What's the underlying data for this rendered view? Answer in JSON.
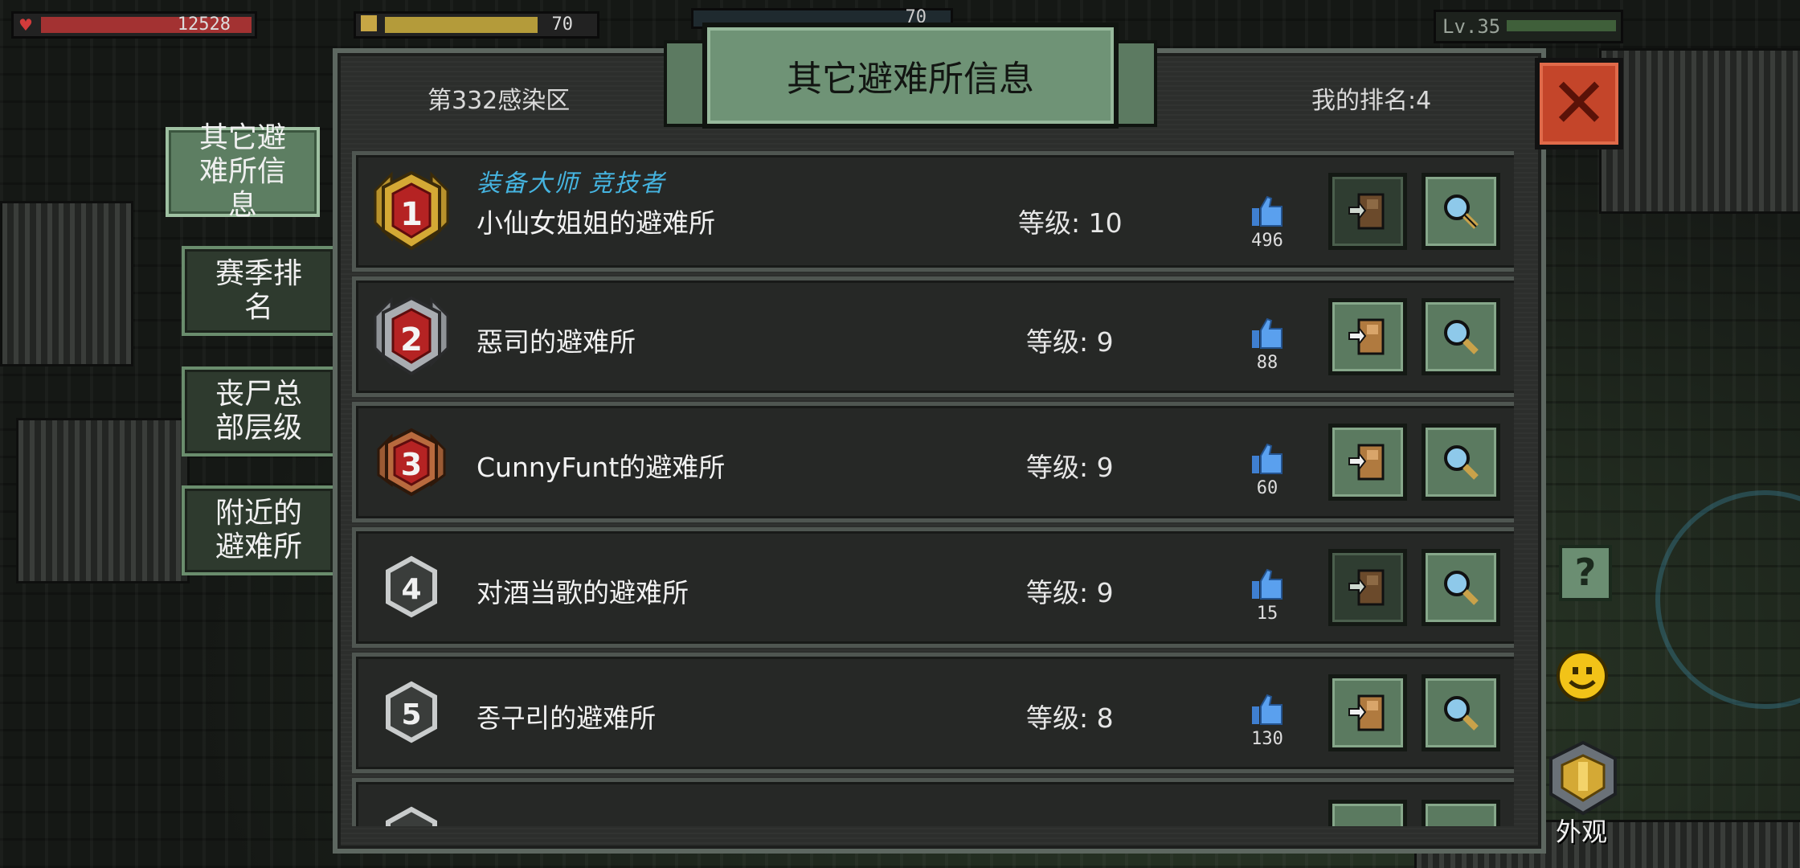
{
  "hud": {
    "hp": "12528",
    "food": "70",
    "water": "70",
    "level": "Lv.35"
  },
  "side_tabs": [
    {
      "label": "其它避难所信息",
      "active": true
    },
    {
      "label": "赛季排名",
      "active": false
    },
    {
      "label": "丧尸总部层级",
      "active": false
    },
    {
      "label": "附近的避难所",
      "active": false
    }
  ],
  "panel": {
    "title": "其它避难所信息",
    "zone": "第332感染区",
    "my_rank": "我的排名:4",
    "close_icon": "close-x-icon"
  },
  "rows": [
    {
      "rank": "1",
      "title_tags": "装备大师  竞技者",
      "name": "小仙女姐姐的避难所",
      "level": "等级: 10",
      "likes": "496",
      "visit_enabled": false
    },
    {
      "rank": "2",
      "title_tags": "",
      "name": "惡司的避难所",
      "level": "等级: 9",
      "likes": "88",
      "visit_enabled": true
    },
    {
      "rank": "3",
      "title_tags": "",
      "name": "CunnyFunt的避难所",
      "level": "等级: 9",
      "likes": "60",
      "visit_enabled": true
    },
    {
      "rank": "4",
      "title_tags": "",
      "name": "对酒当歌的避难所",
      "level": "等级: 9",
      "likes": "15",
      "visit_enabled": false
    },
    {
      "rank": "5",
      "title_tags": "",
      "name": "종구리的避难所",
      "level": "等级: 8",
      "likes": "130",
      "visit_enabled": true
    }
  ],
  "right_widgets": {
    "help_icon": "?",
    "outlook_label": "外观"
  },
  "colors": {
    "accent_green": "#6f9376",
    "close_red": "#c4452a",
    "title_tag_blue": "#45b4e0",
    "gold": "#d4a935",
    "silver": "#a9adb1",
    "bronze": "#b86a3e"
  }
}
